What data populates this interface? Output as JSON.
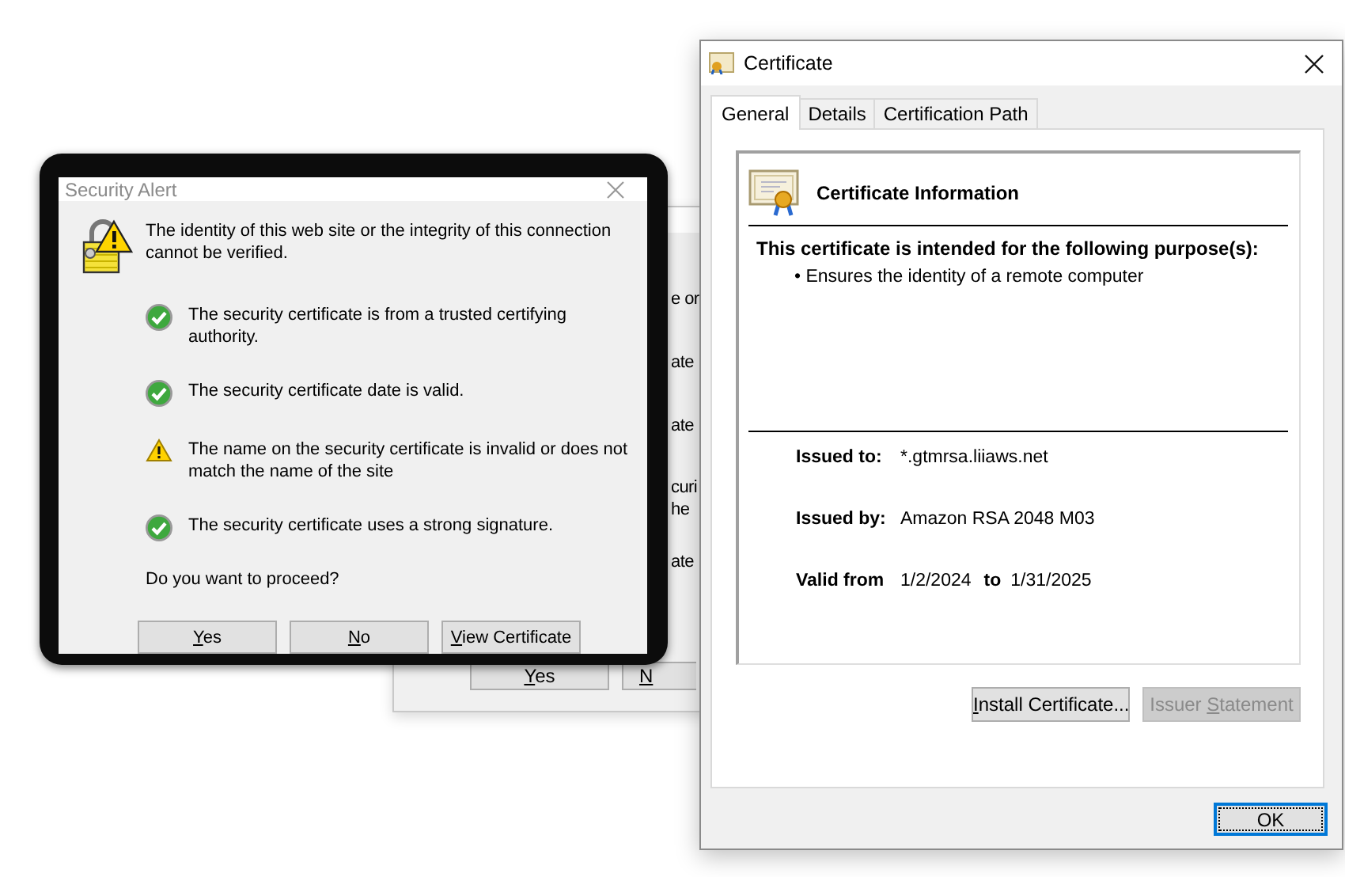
{
  "background_alert": {
    "fragments": [
      "e or",
      "ate",
      "ate",
      "curi",
      "he",
      "ate"
    ],
    "buttons": [
      {
        "key": "Y",
        "after": "es",
        "disabled": false
      },
      {
        "key": "N",
        "disabled": false
      }
    ]
  },
  "security_alert": {
    "title": "Security Alert",
    "message": "The identity of this web site or the integrity of this connection cannot be verified.",
    "checks": [
      {
        "kind": "ok",
        "text": "The security certificate is from a trusted certifying authority."
      },
      {
        "kind": "ok",
        "text": "The security certificate date is valid."
      },
      {
        "kind": "warning",
        "text": "The name on the security certificate is invalid or does not match the name of the site"
      },
      {
        "kind": "ok",
        "text": "The security certificate uses a strong signature."
      }
    ],
    "question": "Do you want to proceed?",
    "buttons": [
      {
        "key": "Y",
        "after": "es",
        "disabled": false
      },
      {
        "key": "N",
        "after": "o",
        "disabled": false
      },
      {
        "key": "V",
        "after": "iew Certificate",
        "disabled": false
      }
    ]
  },
  "certificate": {
    "title": "Certificate",
    "tabs": [
      {
        "label": "General",
        "selected": true
      },
      {
        "label": "Details",
        "selected": false
      },
      {
        "label": "Certification Path",
        "selected": false
      }
    ],
    "heading": "Certificate Information",
    "purpose_heading": "This certificate is intended for the following purpose(s):",
    "purposes": [
      "• Ensures the identity of a remote computer"
    ],
    "issued_to": {
      "label": "Issued to:",
      "value": "*.gtmrsa.liiaws.net"
    },
    "issued_by": {
      "label": "Issued by:",
      "value": "Amazon RSA 2048 M03"
    },
    "validity": {
      "label": "Valid from",
      "from": "1/2/2024",
      "to_label": "to",
      "to": "1/31/2025"
    },
    "buttons": [
      {
        "key": "I",
        "after": "nstall Certificate...",
        "disabled": false
      },
      {
        "before": "Issuer ",
        "key": "S",
        "after": "tatement",
        "disabled": true
      }
    ],
    "ok": {
      "label": "OK",
      "focused": true
    }
  }
}
